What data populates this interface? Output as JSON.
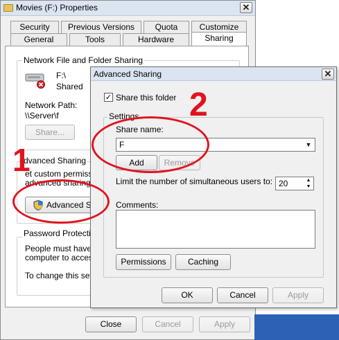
{
  "props": {
    "title": "Movies (F:) Properties",
    "close": "✕",
    "tabs_top": [
      "Security",
      "Previous Versions",
      "Quota",
      "Customize"
    ],
    "tabs_bottom": [
      "General",
      "Tools",
      "Hardware",
      "Sharing"
    ],
    "network_group": {
      "label": "Network File and Folder Sharing",
      "drive": "F:\\",
      "status": "Shared",
      "path_label": "Network Path:",
      "path_value": "\\\\Server\\f",
      "share_button": "Share..."
    },
    "advanced_group": {
      "label": "dvanced Sharing",
      "text_line1": "et custom permissi",
      "text_line2": "advanced sharing op",
      "button": "Advanced Sh"
    },
    "password_group": {
      "label": "Password Protection",
      "line1": "People must have a",
      "line2": "computer to access",
      "line3": "To change this setti"
    },
    "buttons": {
      "close": "Close",
      "cancel": "Cancel",
      "apply": "Apply"
    }
  },
  "advanced": {
    "title": "Advanced Sharing",
    "close": "✕",
    "share_this_folder": "Share this folder",
    "share_checked": "✓",
    "settings_label": "Settings",
    "share_name_label": "Share name:",
    "share_name_value": "F",
    "dropdown_arrow": "▼",
    "add": "Add",
    "remove": "Remove",
    "limit_label": "Limit the number of simultaneous users to:",
    "limit_value": "20",
    "spin_up": "▲",
    "spin_down": "▼",
    "comments_label": "Comments:",
    "permissions": "Permissions",
    "caching": "Caching",
    "ok": "OK",
    "cancel": "Cancel",
    "apply": "Apply"
  },
  "annotations": {
    "step1": "1",
    "step2": "2"
  },
  "colors": {
    "annotation_red": "#e0141e",
    "title_bar": "#dbe5f1",
    "taskbar_blue": "#2c61b5"
  }
}
